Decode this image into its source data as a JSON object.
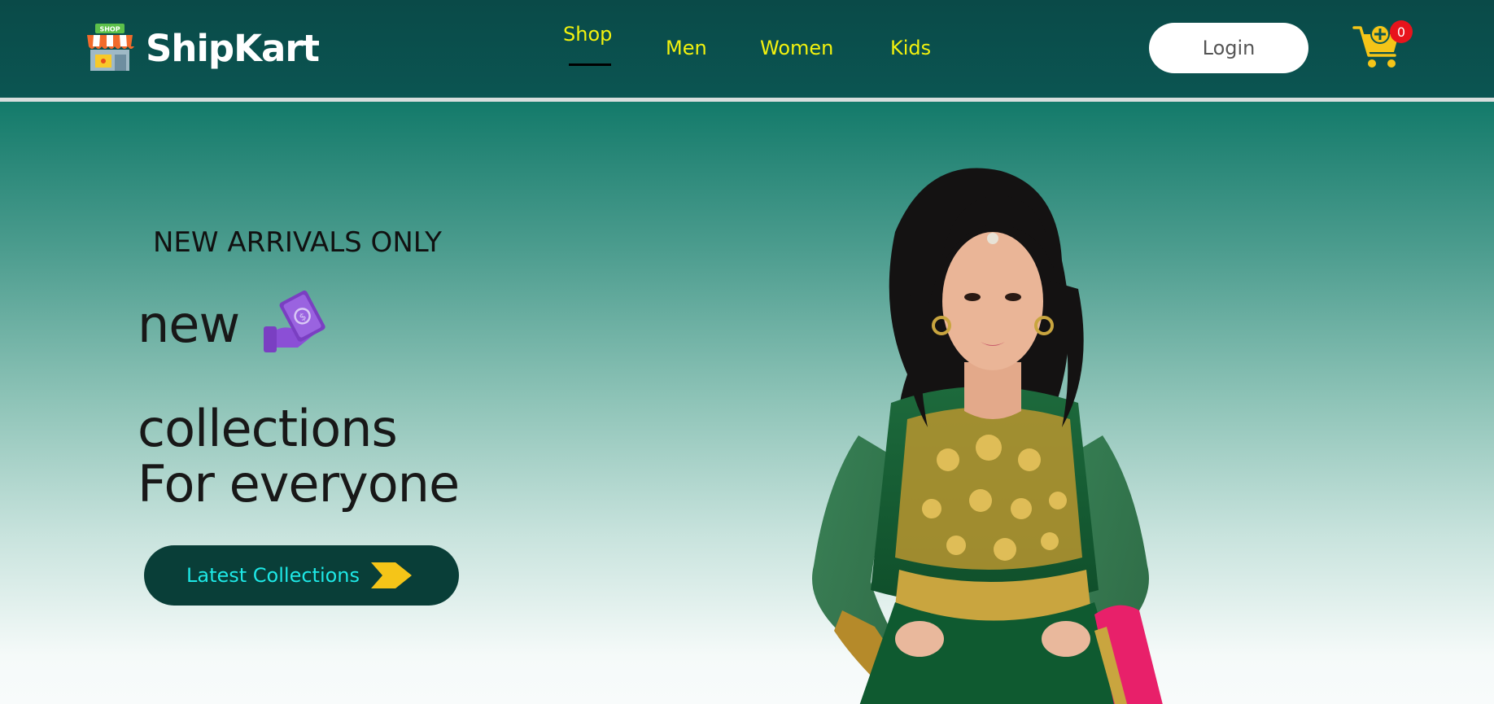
{
  "navbar": {
    "brand": "ShipKart",
    "logo_badge": "SHOP",
    "links": [
      {
        "label": "Shop",
        "active": true
      },
      {
        "label": "Men",
        "active": false
      },
      {
        "label": "Women",
        "active": false
      },
      {
        "label": "Kids",
        "active": false
      }
    ],
    "login_label": "Login",
    "cart_count": "0",
    "colors": {
      "bar": "#0b5552",
      "link": "#f2f20e",
      "badge": "#e8141c"
    }
  },
  "hero": {
    "tagline": "NEW ARRIVALS ONLY",
    "headline_word": "new",
    "headline_line2": "collections",
    "headline_line3": "For everyone",
    "cta_label": "Latest Collections",
    "icons": [
      "money-hand-icon",
      "chevron-arrow-icon"
    ],
    "colors": {
      "cta_bg": "#093e38",
      "cta_text": "#1ee8e6",
      "arrow": "#f5c518"
    }
  }
}
